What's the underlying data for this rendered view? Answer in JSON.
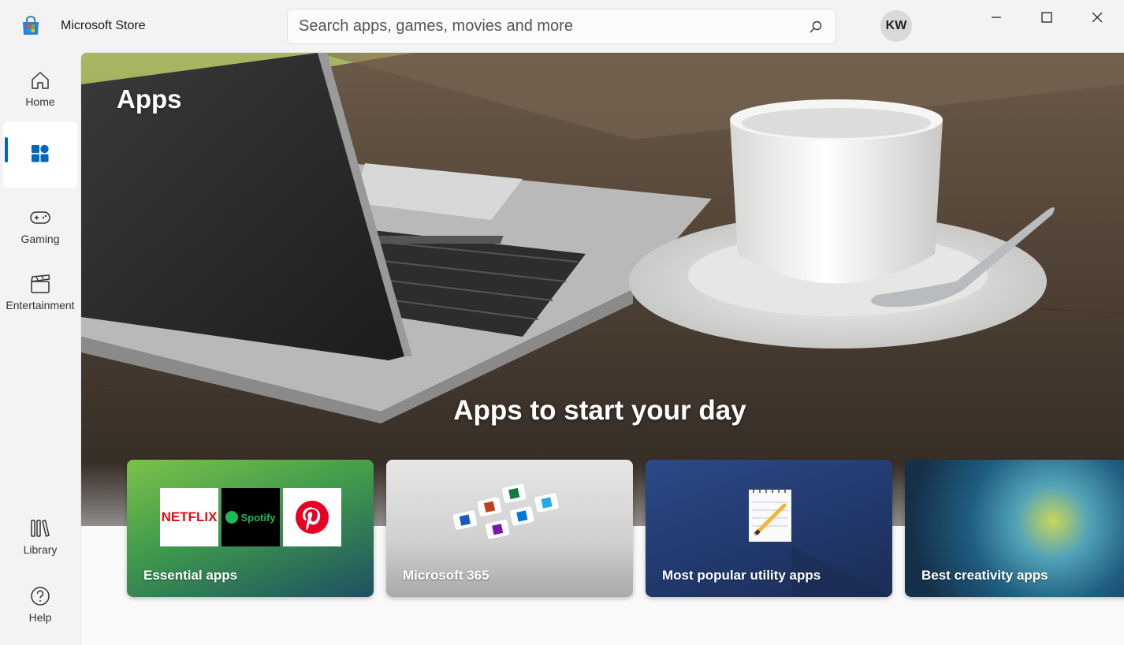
{
  "window": {
    "title": "Microsoft Store",
    "avatar_initials": "KW"
  },
  "search": {
    "placeholder": "Search apps, games, movies and more"
  },
  "sidebar": {
    "items": [
      {
        "label": "Home",
        "icon": "home-icon"
      },
      {
        "label": "",
        "icon": "apps-icon",
        "active": true
      },
      {
        "label": "Gaming",
        "icon": "gamepad-icon"
      },
      {
        "label": "Entertainment",
        "icon": "clapperboard-icon"
      },
      {
        "label": "Library",
        "icon": "library-icon"
      },
      {
        "label": "Help",
        "icon": "help-icon"
      }
    ]
  },
  "main": {
    "page_title": "Apps",
    "section_title": "Apps to start your day",
    "cards": [
      {
        "label": "Essential apps",
        "logos": [
          "NETFLIX",
          "Spotify",
          "Pinterest"
        ]
      },
      {
        "label": "Microsoft 365"
      },
      {
        "label": "Most popular utility apps"
      },
      {
        "label": "Best creativity apps"
      }
    ]
  },
  "colors": {
    "accent": "#0067c0",
    "background": "#f3f3f3"
  }
}
